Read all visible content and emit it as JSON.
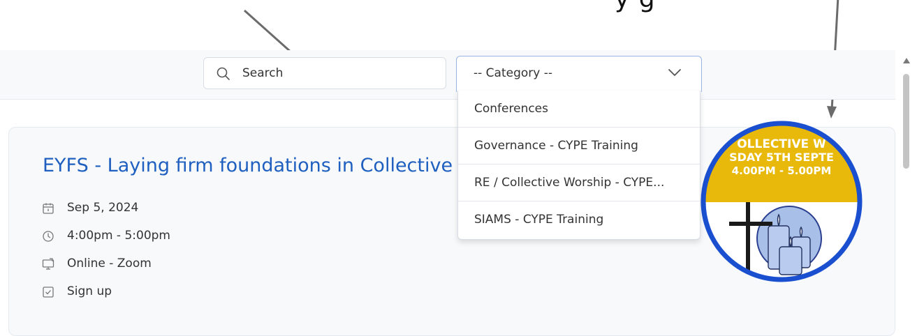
{
  "annotation": {
    "top_text_fragment": "y      g"
  },
  "toolbar": {
    "search": {
      "placeholder": "Search",
      "icon": "search-icon"
    },
    "category_select": {
      "selected": "-- Category --",
      "icon": "chevron-down-icon",
      "options": [
        "Conferences",
        "Governance - CYPE Training",
        "RE / Collective Worship - CYPE...",
        "SIAMS - CYPE Training"
      ]
    }
  },
  "event": {
    "title": "EYFS - Laying firm foundations in Collective Worship",
    "date": "Sep 5, 2024",
    "time": "4:00pm - 5:00pm",
    "location": "Online - Zoom",
    "signup": "Sign up",
    "image": {
      "banner_line1": "OLLECTIVE W",
      "banner_line2": "SDAY 5TH SEPTE",
      "banner_line3": "4.00PM - 5.00PM"
    }
  },
  "colors": {
    "title_blue": "#1f5fbf",
    "select_border": "#9ab4e4",
    "image_ring": "#1a4fd0",
    "image_banner": "#e8b90a"
  }
}
